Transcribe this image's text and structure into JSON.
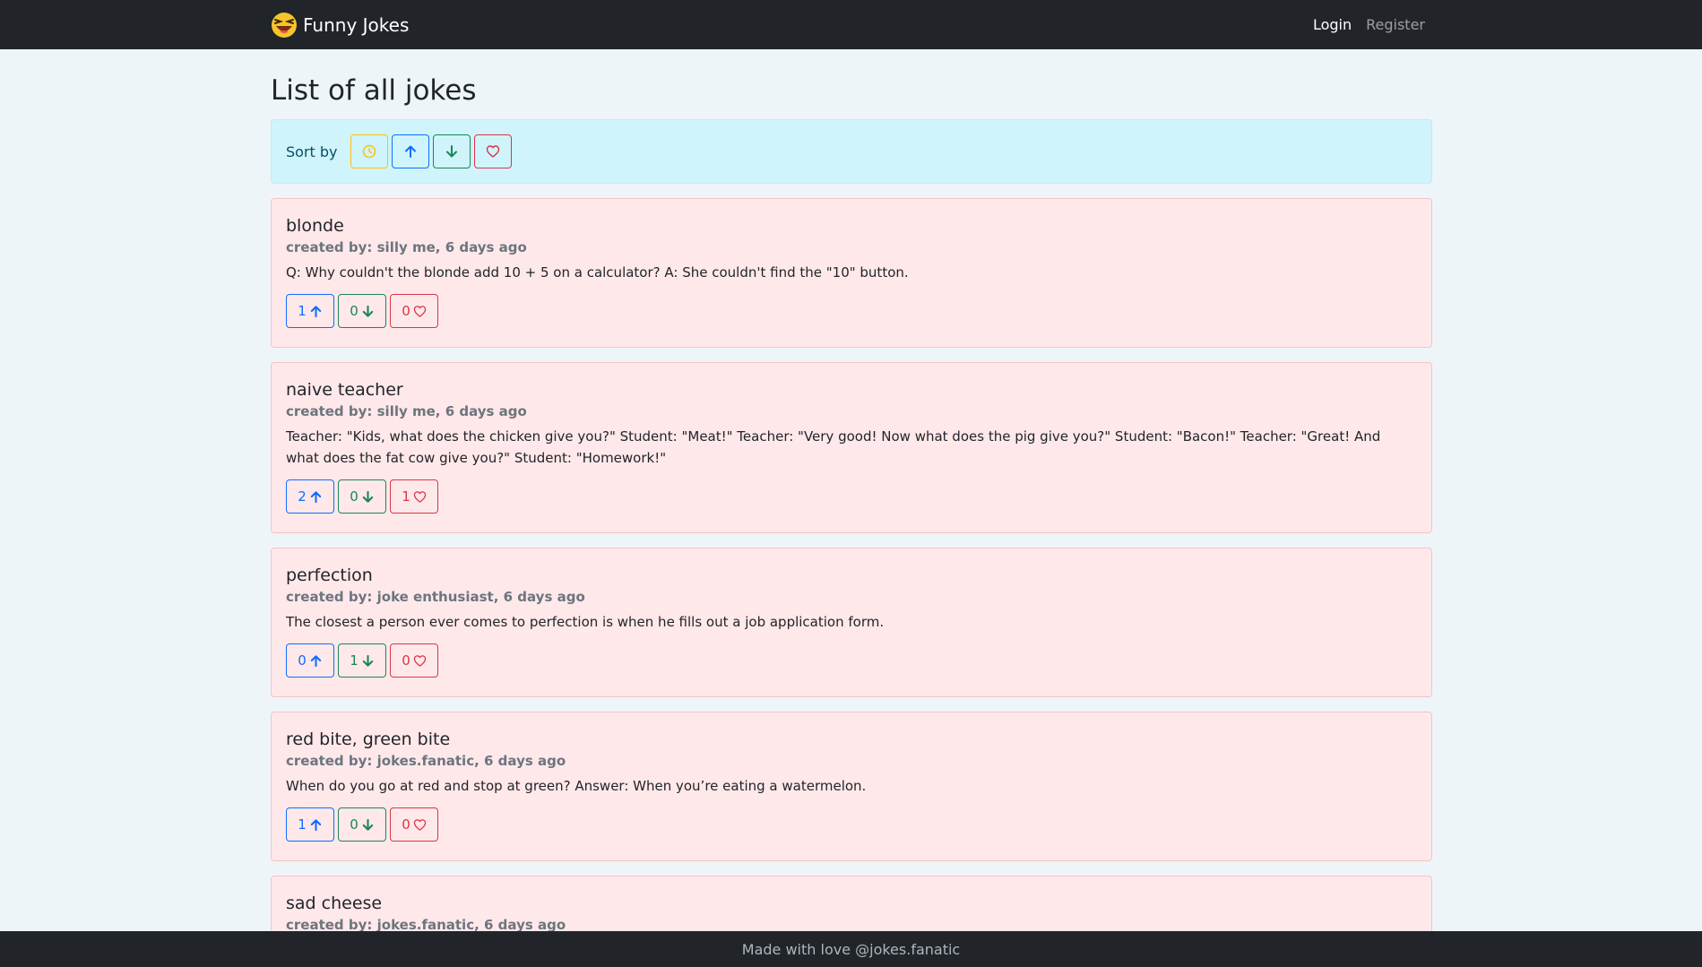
{
  "nav": {
    "brand": "Funny Jokes",
    "login": "Login",
    "register": "Register"
  },
  "page": {
    "title": "List of all jokes"
  },
  "sort": {
    "label": "Sort by"
  },
  "jokes": [
    {
      "title": "blonde",
      "meta": "created by: silly me, 6 days ago",
      "text": "Q: Why couldn't the blonde add 10 + 5 on a calculator? A: She couldn't find the \"10\" button.",
      "up": "1",
      "down": "0",
      "likes": "0"
    },
    {
      "title": "naive teacher",
      "meta": "created by: silly me, 6 days ago",
      "text": "Teacher: \"Kids, what does the chicken give you?\" Student: \"Meat!\" Teacher: \"Very good! Now what does the pig give you?\" Student: \"Bacon!\" Teacher: \"Great! And what does the fat cow give you?\" Student: \"Homework!\"",
      "up": "2",
      "down": "0",
      "likes": "1"
    },
    {
      "title": "perfection",
      "meta": "created by: joke enthusiast, 6 days ago",
      "text": "The closest a person ever comes to perfection is when he fills out a job application form.",
      "up": "0",
      "down": "1",
      "likes": "0"
    },
    {
      "title": "red bite, green bite",
      "meta": "created by: jokes.fanatic, 6 days ago",
      "text": "When do you go at red and stop at green? Answer: When you’re eating a watermelon.",
      "up": "1",
      "down": "0",
      "likes": "0"
    },
    {
      "title": "sad cheese",
      "meta": "created by: jokes.fanatic, 6 days ago"
    }
  ],
  "footer": {
    "text": "Made with love @jokes.fanatic"
  }
}
